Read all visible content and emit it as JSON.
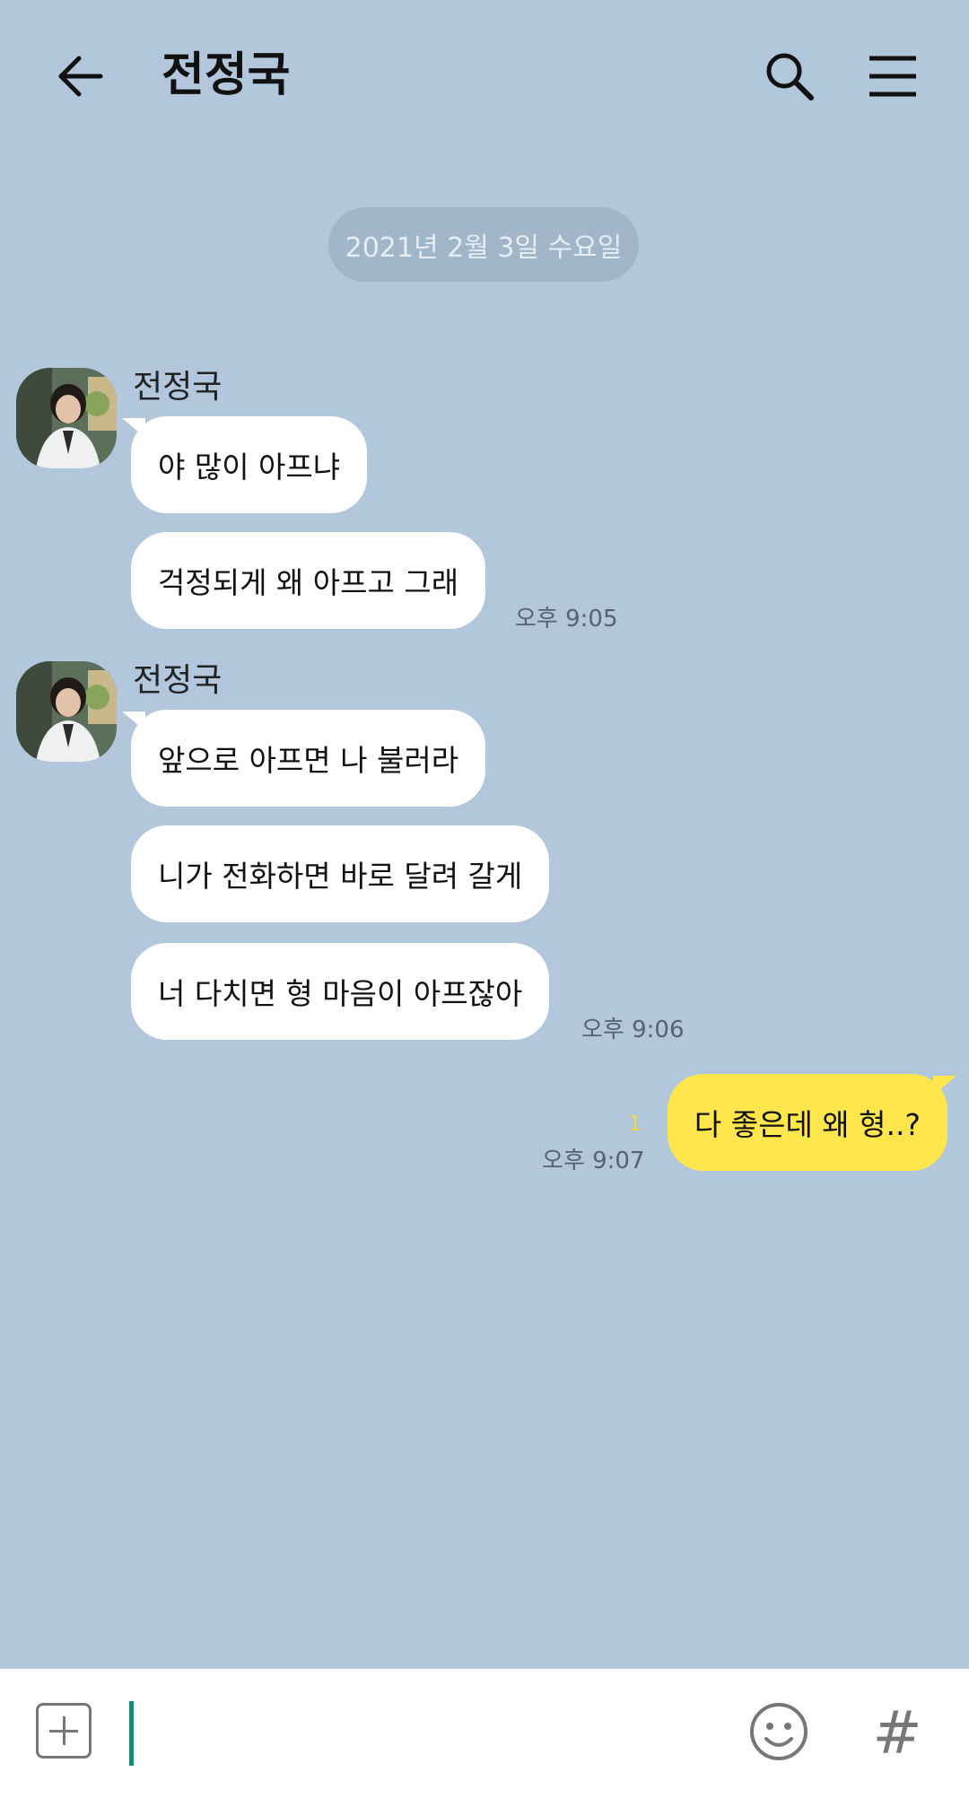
{
  "header": {
    "title": "전정국",
    "back_icon": "arrow-left-icon",
    "search_icon": "search-icon",
    "menu_icon": "hamburger-menu-icon"
  },
  "date_divider": "2021년 2월 3일 수요일",
  "groups": [
    {
      "sender": "전정국",
      "messages": [
        "야 많이 아프냐",
        "걱정되게 왜 아프고 그래"
      ],
      "time": "오후 9:05"
    },
    {
      "sender": "전정국",
      "messages": [
        "앞으로 아프면 나 불러라",
        "니가 전화하면 바로 달려 갈게",
        "너 다치면 형 마음이 아프잖아"
      ],
      "time": "오후 9:06"
    }
  ],
  "my_message": {
    "text": "다 좋은데 왜 형..?",
    "unread": "1",
    "time": "오후 9:07"
  },
  "input_bar": {
    "value": "",
    "plus_icon": "plus-icon",
    "emoji_icon": "smiley-icon",
    "hash_label": "#"
  },
  "colors": {
    "background": "#b2c7dc",
    "my_bubble": "#fee64c",
    "other_bubble": "#ffffff",
    "cursor": "#148c78"
  }
}
